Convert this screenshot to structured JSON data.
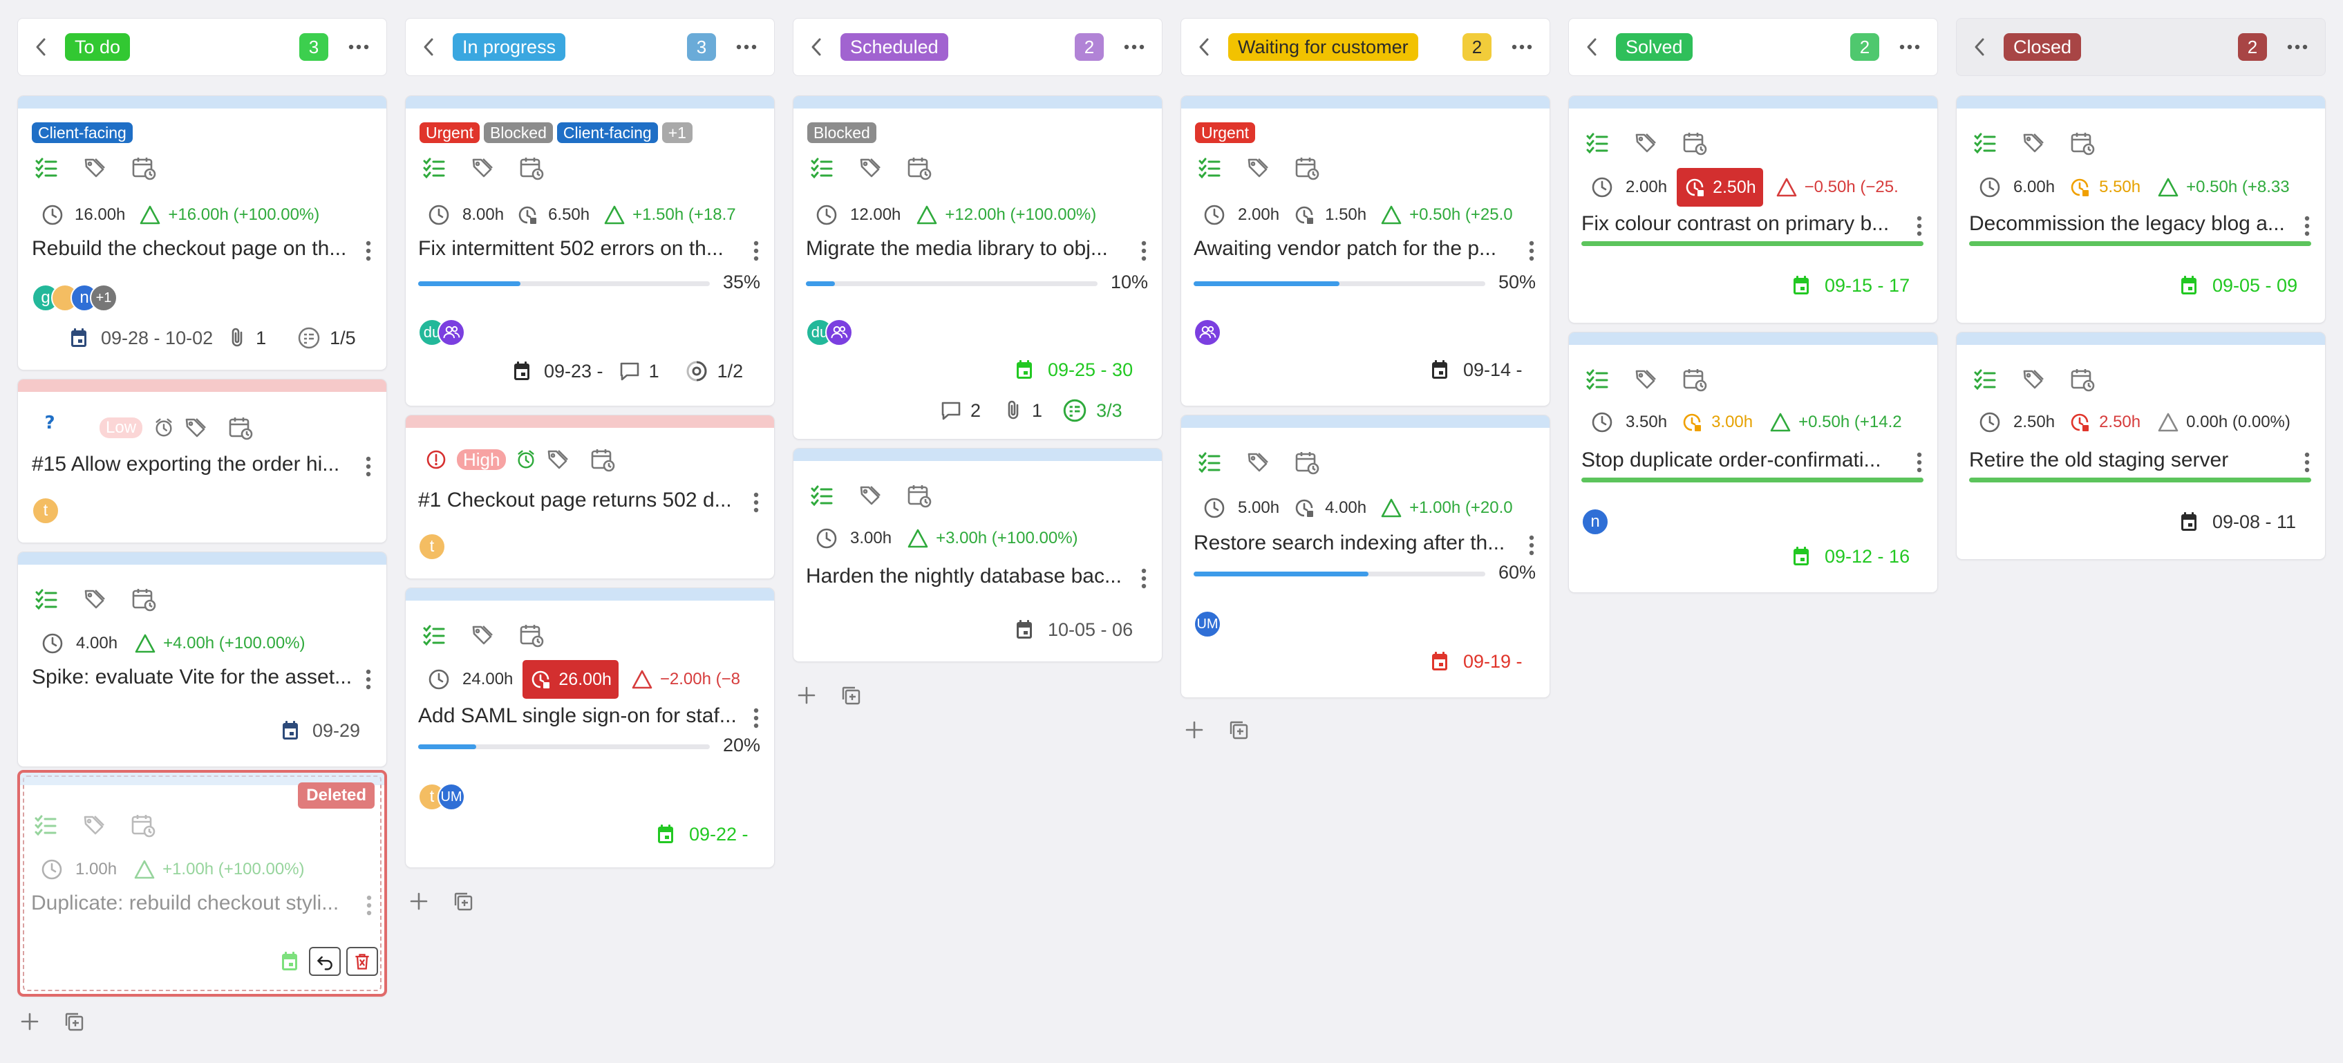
{
  "colors": {
    "green": "#3ccf4e",
    "blue": "#3aa7e0",
    "purple": "#a163d0",
    "yellow": "#f2c200",
    "darkred": "#a84545",
    "urgent": "#e0352b",
    "blocked": "#8c8c8c",
    "clientfacing": "#1f6fc6"
  },
  "columns": [
    {
      "name": "To do",
      "count": "3"
    },
    {
      "name": "In progress",
      "count": "3"
    },
    {
      "name": "Scheduled",
      "count": "2"
    },
    {
      "name": "Waiting for customer",
      "count": "2"
    },
    {
      "name": "Solved",
      "count": "2"
    },
    {
      "name": "Closed",
      "count": "2"
    }
  ],
  "c1": {
    "card1": {
      "tag": "Client-facing",
      "time": "16.00h",
      "delta": "+16.00h (+100.00%)",
      "title": "Rebuild the checkout page on th...",
      "avatars": [
        "g",
        "",
        "n",
        "+1"
      ],
      "dates": "09-28 - 10-02",
      "attachments": "1",
      "subtasks": "1/5"
    },
    "card2": {
      "priority": "Low",
      "title": "#15 Allow exporting the order hi...",
      "avatar": "t"
    },
    "card3": {
      "time": "4.00h",
      "delta": "+4.00h (+100.00%)",
      "title": "Spike: evaluate Vite for the asset...",
      "date": "09-29"
    },
    "card4": {
      "badge": "Deleted",
      "time": "1.00h",
      "delta": "+1.00h (+100.00%)",
      "title": "Duplicate: rebuild checkout styli..."
    }
  },
  "c2": {
    "card1": {
      "tags": [
        "Urgent",
        "Blocked",
        "Client-facing",
        "+1"
      ],
      "time": "8.00h",
      "spent": "6.50h",
      "delta": "+1.50h (+18.7",
      "title": "Fix intermittent 502 errors on th...",
      "progress_pct": 35,
      "progress_label": "35%",
      "avatars": [
        "du",
        ""
      ],
      "date": "09-23 -",
      "comments": "1",
      "subtasks": "1/2"
    },
    "card2": {
      "priority": "High",
      "title": "#1 Checkout page returns 502 d...",
      "avatar": "t"
    },
    "card3": {
      "time": "24.00h",
      "spent": "26.00h",
      "delta": "−2.00h (−8",
      "title": "Add SAML single sign-on for staf...",
      "progress_pct": 20,
      "progress_label": "20%",
      "avatars": [
        "t",
        "UM"
      ],
      "date": "09-22 -"
    }
  },
  "c3": {
    "card1": {
      "tag": "Blocked",
      "time": "12.00h",
      "delta": "+12.00h (+100.00%)",
      "title": "Migrate the media library to obj...",
      "progress_pct": 10,
      "progress_label": "10%",
      "avatars": [
        "du",
        ""
      ],
      "date": "09-25 - 30",
      "comments": "2",
      "attachments": "1",
      "subtasks": "3/3"
    },
    "card2": {
      "time": "3.00h",
      "delta": "+3.00h (+100.00%)",
      "title": "Harden the nightly database bac...",
      "date": "10-05 - 06"
    }
  },
  "c4": {
    "card1": {
      "tag": "Urgent",
      "time": "2.00h",
      "spent": "1.50h",
      "delta": "+0.50h (+25.0",
      "title": "Awaiting vendor patch for the p...",
      "progress_pct": 50,
      "progress_label": "50%",
      "date": "09-14 -"
    },
    "card2": {
      "time": "5.00h",
      "spent": "4.00h",
      "delta": "+1.00h (+20.0",
      "title": "Restore search indexing after th...",
      "progress_pct": 60,
      "progress_label": "60%",
      "avatar": "UM",
      "date": "09-19 -"
    }
  },
  "c5": {
    "card1": {
      "time": "2.00h",
      "spent": "2.50h",
      "delta": "−0.50h (−25.",
      "title": "Fix colour contrast on primary b...",
      "date": "09-15 - 17"
    },
    "card2": {
      "time": "3.50h",
      "spent": "3.00h",
      "delta": "+0.50h (+14.2",
      "title": "Stop duplicate order-confirmati...",
      "avatar": "n",
      "date": "09-12 - 16"
    }
  },
  "c6": {
    "card1": {
      "time": "6.00h",
      "spent": "5.50h",
      "delta": "+0.50h (+8.33",
      "title": "Decommission the legacy blog a...",
      "date": "09-05 - 09"
    },
    "card2": {
      "time": "2.50h",
      "spent": "2.50h",
      "delta": "0.00h (0.00%)",
      "title": "Retire the old staging server",
      "date": "09-08 - 11"
    }
  }
}
